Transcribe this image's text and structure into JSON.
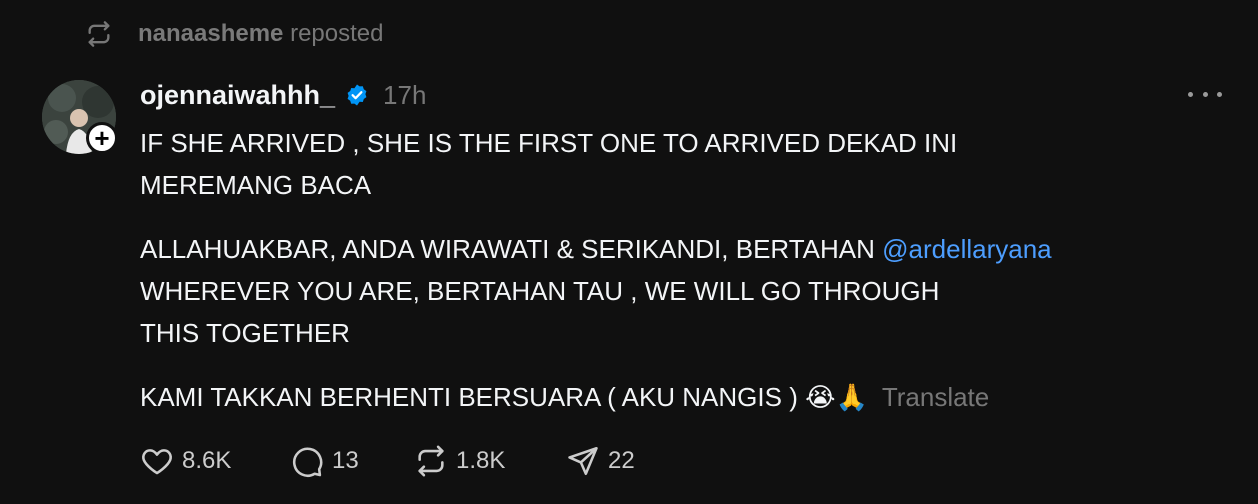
{
  "repost": {
    "user": "nanaasheme",
    "label": "reposted"
  },
  "post": {
    "username": "ojennaiwahhh_",
    "time": "17h",
    "lines1": [
      "IF SHE ARRIVED , SHE IS THE FIRST ONE TO ARRIVED DEKAD INI",
      "MEREMANG BACA"
    ],
    "para2_line1": "ALLAHUAKBAR, ANDA WIRAWATI & SERIKANDI, BERTAHAN ",
    "mention": "@ardellaryana",
    "para2_line2": "WHEREVER YOU ARE, BERTAHAN TAU , WE WILL GO THROUGH",
    "para2_line3": "THIS TOGETHER",
    "para3": "KAMI TAKKAN BERHENTI BERSUARA ( AKU NANGIS ) 😭🙏",
    "translate": "Translate",
    "follow_symbol": "+"
  },
  "actions": {
    "likes": "8.6K",
    "replies": "13",
    "reposts": "1.8K",
    "shares": "22"
  },
  "icons": [
    "repost-icon",
    "verified-badge-icon",
    "more-options-icon",
    "heart-icon",
    "comment-icon",
    "repost-icon",
    "share-icon",
    "plus-icon"
  ],
  "colors": {
    "background": "#101010",
    "text": "#f3f5f7",
    "muted": "#777777",
    "link": "#4d9eff",
    "verified": "#0095f6"
  }
}
